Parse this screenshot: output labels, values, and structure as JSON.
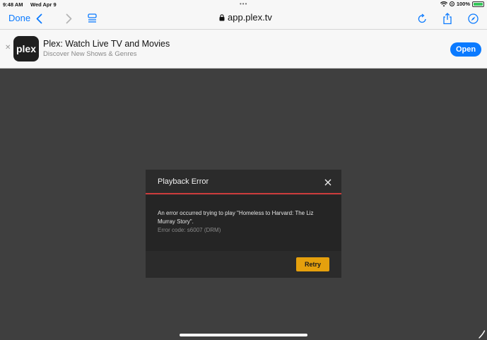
{
  "status": {
    "time": "9:48 AM",
    "date": "Wed Apr 9",
    "battery_pct": "100%",
    "dots": "•••"
  },
  "toolbar": {
    "done_label": "Done",
    "url": "app.plex.tv"
  },
  "banner": {
    "app_title": "Plex: Watch Live TV and Movies",
    "subtitle": "Discover New Shows & Genres",
    "open_label": "Open",
    "icon_text": "plex",
    "close": "✕"
  },
  "modal": {
    "title": "Playback Error",
    "message": "An error occurred trying to play \"Homeless to Harvard: The Liz Murray Story\".",
    "error_code": "Error code: s6007 (DRM)",
    "retry_label": "Retry"
  },
  "colors": {
    "accent_blue": "#0a7aff",
    "plex_gold": "#e5a00d",
    "error_red": "#cc3c3c"
  }
}
